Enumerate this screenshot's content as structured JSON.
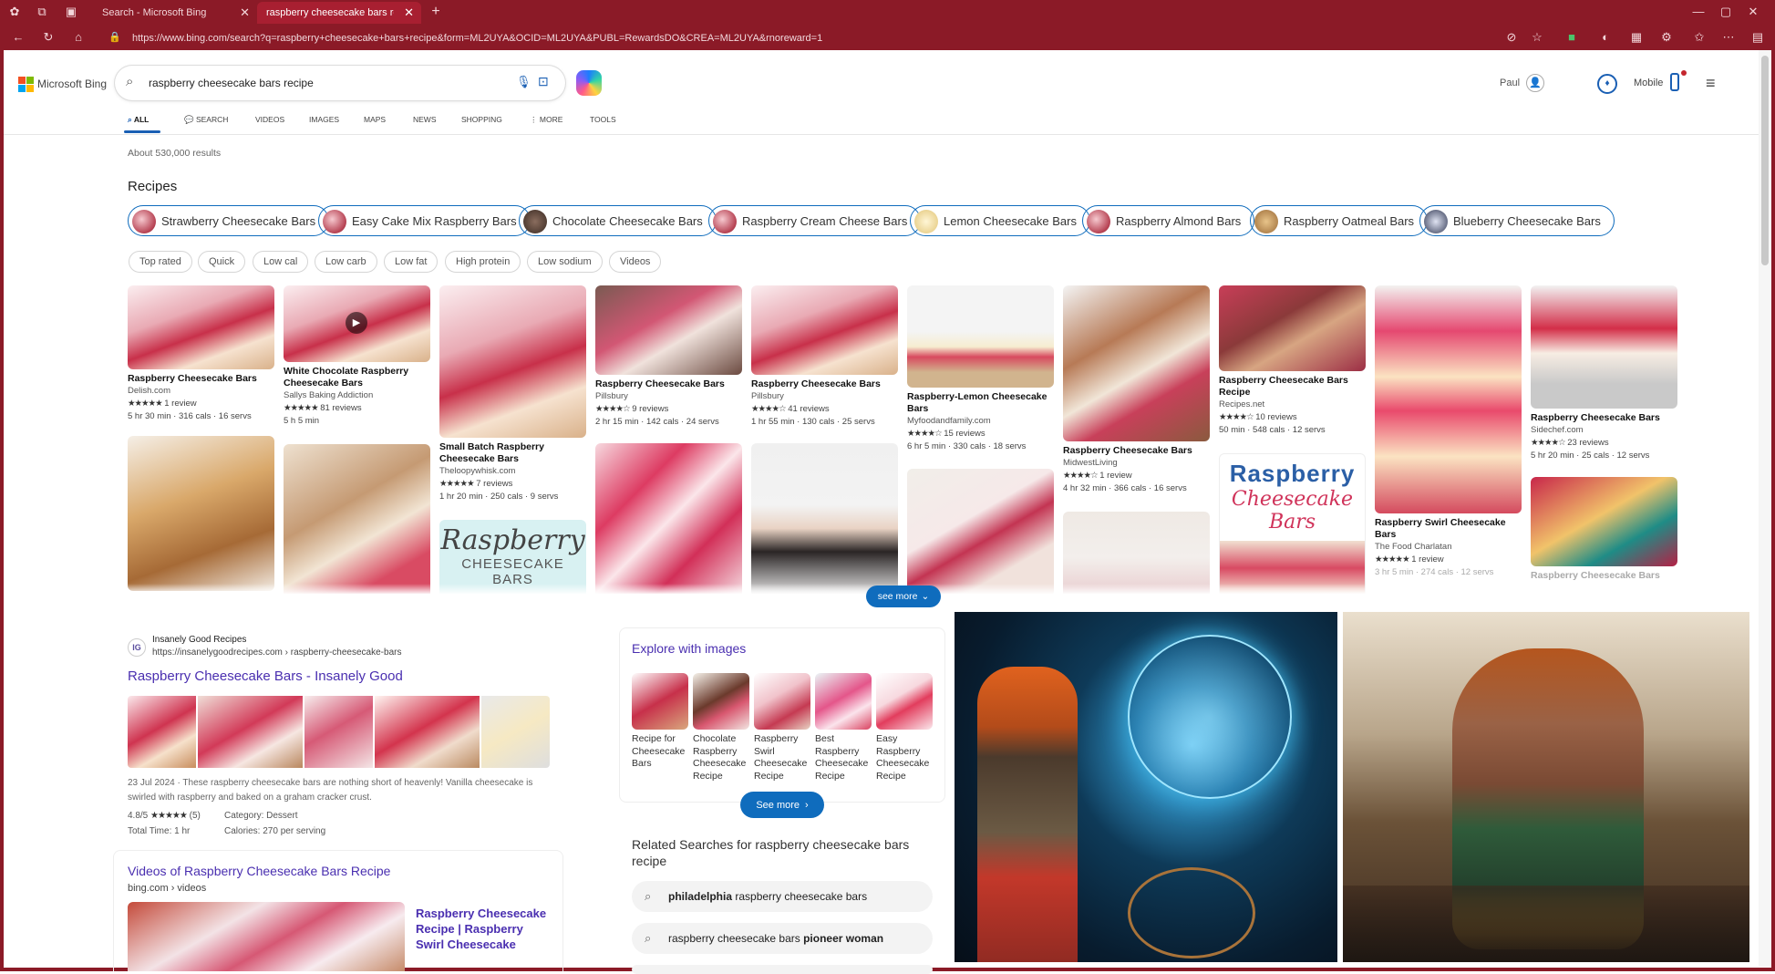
{
  "browser": {
    "tabs": [
      {
        "label": "Search - Microsoft Bing"
      },
      {
        "label": "raspberry cheesecake bars recipe"
      }
    ],
    "url": "https://www.bing.com/search?q=raspberry+cheesecake+bars+recipe&form=ML2UYA&OCID=ML2UYA&PUBL=RewardsDO&CREA=ML2UYA&rnoreward=1",
    "accent": "#8b1a27"
  },
  "header": {
    "logo": "Microsoft Bing",
    "search_value": "raspberry cheesecake bars recipe",
    "user": "Paul",
    "mobile_label": "Mobile"
  },
  "nav": {
    "tabs": [
      "ALL",
      "SEARCH",
      "VIDEOS",
      "IMAGES",
      "MAPS",
      "NEWS",
      "SHOPPING",
      "MORE",
      "TOOLS"
    ],
    "active": "ALL"
  },
  "results": {
    "count": "About 530,000 results",
    "recipes_heading": "Recipes",
    "chips": [
      "Strawberry Cheesecake Bars",
      "Easy Cake Mix Raspberry Bars",
      "Chocolate Cheesecake Bars",
      "Raspberry Cream Cheese Bars",
      "Lemon Cheesecake Bars",
      "Raspberry Almond Bars",
      "Raspberry Oatmeal Bars",
      "Blueberry Cheesecake Bars"
    ],
    "filters": [
      "Top rated",
      "Quick",
      "Low cal",
      "Low carb",
      "Low fat",
      "High protein",
      "Low sodium",
      "Videos"
    ],
    "see_more": "see more"
  },
  "recipe_cards": [
    {
      "title": "Raspberry Cheesecake Bars",
      "source": "Delish.com",
      "stars": "★★★★★",
      "reviews": "1 review",
      "meta": "5 hr 30 min · 316 cals · 16 servs"
    },
    {
      "title": "White Chocolate Raspberry Cheesecake Bars",
      "source": "Sallys Baking Addiction",
      "stars": "★★★★★",
      "reviews": "81 reviews",
      "meta": "5 h 5 min"
    },
    {
      "title": "Small Batch Raspberry Cheesecake Bars",
      "source": "Theloopywhisk.com",
      "stars": "★★★★★",
      "reviews": "7 reviews",
      "meta": "1 hr 20 min · 250 cals · 9 servs"
    },
    {
      "title": "Raspberry Cheesecake Bars",
      "source": "Pillsbury",
      "stars": "★★★★☆",
      "reviews": "9 reviews",
      "meta": "2 hr 15 min · 142 cals · 24 servs"
    },
    {
      "title": "Raspberry Cheesecake Bars",
      "source": "Pillsbury",
      "stars": "★★★★☆",
      "reviews": "41 reviews",
      "meta": "1 hr 55 min · 130 cals · 25 servs"
    },
    {
      "title": "Raspberry-Lemon Cheesecake Bars",
      "source": "Myfoodandfamily.com",
      "stars": "★★★★☆",
      "reviews": "15 reviews",
      "meta": "6 hr 5 min · 330 cals · 18 servs"
    },
    {
      "title": "Raspberry Cheesecake Bars",
      "source": "MidwestLiving",
      "stars": "★★★★☆",
      "reviews": "1 review",
      "meta": "4 hr 32 min · 366 cals · 16 servs"
    },
    {
      "title": "Raspberry Cheesecake Bars Recipe",
      "source": "Recipes.net",
      "stars": "★★★★☆",
      "reviews": "10 reviews",
      "meta": "50 min · 548 cals · 12 servs"
    },
    {
      "title": "Raspberry Swirl Cheesecake Bars",
      "source": "The Food Charlatan",
      "stars": "★★★★★",
      "reviews": "1 review",
      "meta": "3 hr 5 min · 274 cals · 12 servs"
    },
    {
      "title": "Raspberry Cheesecake Bars",
      "source": "Sidechef.com",
      "stars": "★★★★☆",
      "reviews": "23 reviews",
      "meta": "5 hr 20 min · 25 cals · 12 servs"
    }
  ],
  "banner_text": {
    "raspberry_script": "Raspberry",
    "cheesecake_bars": "CHEESECAKE BARS",
    "cheesecake_script": "Cheesecake Bars"
  },
  "web_result": {
    "site_name": "Insanely Good Recipes",
    "url": "https://insanelygoodrecipes.com › raspberry-cheesecake-bars",
    "title": "Raspberry Cheesecake Bars - Insanely Good",
    "snippet": "23 Jul 2024 · These raspberry cheesecake bars are nothing short of heavenly! Vanilla cheesecake is swirled with raspberry and baked on a graham cracker crust.",
    "rating": "4.8/5",
    "stars": "★★★★★",
    "rating_count": "(5)",
    "category": "Category: Dessert",
    "total_time": "Total Time: 1 hr",
    "calories": "Calories: 270 per serving"
  },
  "videos": {
    "heading": "Videos of Raspberry Cheesecake Bars Recipe",
    "source": "bing.com › videos",
    "video_title": "Raspberry Cheesecake Recipe | Raspberry Swirl Cheesecake"
  },
  "explore": {
    "heading": "Explore with images",
    "items": [
      "Recipe for Cheesecake Bars",
      "Chocolate Raspberry Cheesecake Recipe",
      "Raspberry Swirl Cheesecake Recipe",
      "Best Raspberry Cheesecake Recipe",
      "Easy Raspberry Cheesecake Recipe"
    ],
    "see_more": "See more"
  },
  "related": {
    "heading": "Related Searches for raspberry cheesecake bars recipe",
    "items": [
      {
        "bold": "philadelphia",
        "rest": " raspberry cheesecake bars"
      },
      {
        "pre": "raspberry cheesecake bars ",
        "bold": "pioneer woman"
      }
    ]
  }
}
